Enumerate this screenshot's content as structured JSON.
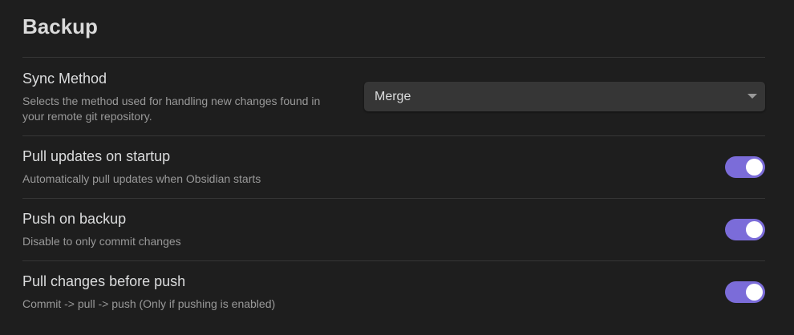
{
  "section": {
    "title": "Backup"
  },
  "settings": {
    "sync_method": {
      "name": "Sync Method",
      "description_line1": "Selects the method used for handling new changes found in",
      "description_line2": "your remote git repository.",
      "selected": "Merge"
    },
    "pull_on_startup": {
      "name": "Pull updates on startup",
      "description": "Automatically pull updates when Obsidian starts",
      "enabled": true
    },
    "push_on_backup": {
      "name": "Push on backup",
      "description": "Disable to only commit changes",
      "enabled": true
    },
    "pull_before_push": {
      "name": "Pull changes before push",
      "description": "Commit -> pull -> push (Only if pushing is enabled)",
      "enabled": true
    }
  },
  "colors": {
    "background": "#1e1e1e",
    "accent": "#7b6cd9",
    "divider": "#363636"
  }
}
